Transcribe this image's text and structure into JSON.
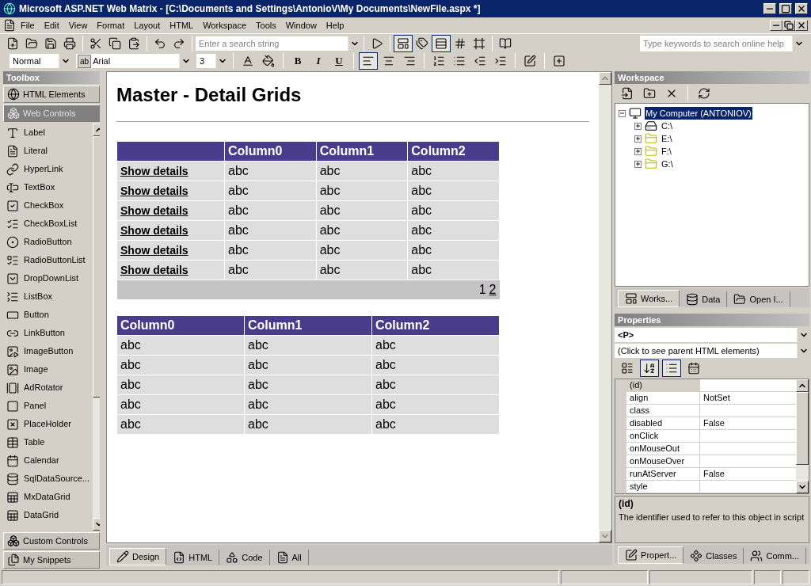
{
  "window": {
    "title": "Microsoft ASP.NET Web Matrix - [C:\\Documents and Settings\\AntonioV\\My Documents\\NewFile.aspx *]"
  },
  "menu": [
    "File",
    "Edit",
    "View",
    "Format",
    "Layout",
    "HTML",
    "Workspace",
    "Tools",
    "Window",
    "Help"
  ],
  "toolbar": {
    "search": {
      "placeholder": "Enter a search string"
    },
    "help_search": {
      "placeholder": "Type keywords to search online help"
    },
    "view_buttons": [
      {
        "selected": true
      },
      {
        "selected": false
      },
      {
        "selected": true
      },
      {
        "selected": false
      },
      {
        "selected": false
      }
    ]
  },
  "format_bar": {
    "block_format": "Normal",
    "font": "Arial",
    "font_prefix": "ab",
    "size": "3",
    "bold": "B",
    "italic": "I",
    "underline": "U",
    "align": [
      {
        "selected": true
      },
      {
        "selected": false
      },
      {
        "selected": false
      }
    ]
  },
  "toolbox": {
    "title": "Toolbox",
    "sections_top": [
      {
        "label": "HTML Elements",
        "selected": false
      },
      {
        "label": "Web Controls",
        "selected": true
      }
    ],
    "items": [
      "Label",
      "Literal",
      "HyperLink",
      "TextBox",
      "CheckBox",
      "CheckBoxList",
      "RadioButton",
      "RadioButtonList",
      "DropDownList",
      "ListBox",
      "Button",
      "LinkButton",
      "ImageButton",
      "Image",
      "AdRotator",
      "Panel",
      "PlaceHolder",
      "Table",
      "Calendar",
      "SqlDataSource...",
      "MxDataGrid",
      "DataGrid"
    ],
    "sections_bottom": [
      {
        "label": "Custom Controls",
        "selected": false
      },
      {
        "label": "My Snippets",
        "selected": false
      }
    ]
  },
  "document": {
    "heading": "Master - Detail Grids",
    "master_grid": {
      "columns": [
        "",
        "Column0",
        "Column1",
        "Column2"
      ],
      "rows": [
        [
          "Show details",
          "abc",
          "abc",
          "abc"
        ],
        [
          "Show details",
          "abc",
          "abc",
          "abc"
        ],
        [
          "Show details",
          "abc",
          "abc",
          "abc"
        ],
        [
          "Show details",
          "abc",
          "abc",
          "abc"
        ],
        [
          "Show details",
          "abc",
          "abc",
          "abc"
        ],
        [
          "Show details",
          "abc",
          "abc",
          "abc"
        ]
      ],
      "pager": [
        {
          "label": "1",
          "selected": true
        },
        {
          "label": "2",
          "selected": false
        }
      ]
    },
    "detail_grid": {
      "columns": [
        "Column0",
        "Column1",
        "Column2"
      ],
      "rows": [
        [
          "abc",
          "abc",
          "abc"
        ],
        [
          "abc",
          "abc",
          "abc"
        ],
        [
          "abc",
          "abc",
          "abc"
        ],
        [
          "abc",
          "abc",
          "abc"
        ],
        [
          "abc",
          "abc",
          "abc"
        ]
      ]
    }
  },
  "editor_tabs": [
    {
      "label": "Design",
      "selected": true
    },
    {
      "label": "HTML",
      "selected": false
    },
    {
      "label": "Code",
      "selected": false
    },
    {
      "label": "All",
      "selected": false
    }
  ],
  "workspace": {
    "title": "Workspace",
    "tree": [
      {
        "label": "My Computer (ANTONIOV)",
        "selected": true,
        "expanded": true,
        "children": [
          {
            "label": "C:\\",
            "selected": false,
            "expanded": false
          },
          {
            "label": "E:\\",
            "selected": false,
            "expanded": false
          },
          {
            "label": "F:\\",
            "selected": false,
            "expanded": false
          },
          {
            "label": "G:\\",
            "selected": false,
            "expanded": false
          }
        ]
      }
    ],
    "tabs": [
      {
        "label": "Works...",
        "selected": true
      },
      {
        "label": "Data",
        "selected": false
      },
      {
        "label": "Open I...",
        "selected": false
      }
    ]
  },
  "properties": {
    "title": "Properties",
    "element": "<P>",
    "parent_hint": "(Click to see parent HTML elements)",
    "tool_buttons": [
      {
        "selected": false
      },
      {
        "selected": true
      },
      {
        "selected": true
      },
      {
        "selected": false
      }
    ],
    "rows": [
      {
        "name": "(id)",
        "value": "",
        "selected": true
      },
      {
        "name": "align",
        "value": "NotSet",
        "selected": false
      },
      {
        "name": "class",
        "value": "",
        "selected": false
      },
      {
        "name": "disabled",
        "value": "False",
        "selected": false
      },
      {
        "name": "onClick",
        "value": "",
        "selected": false
      },
      {
        "name": "onMouseOut",
        "value": "",
        "selected": false
      },
      {
        "name": "onMouseOver",
        "value": "",
        "selected": false
      },
      {
        "name": "runAtServer",
        "value": "False",
        "selected": false
      },
      {
        "name": "style",
        "value": "",
        "selected": false
      }
    ],
    "description_title": "(id)",
    "description": "The identifier used to refer to this object in script",
    "tabs": [
      {
        "label": "Propert...",
        "selected": true
      },
      {
        "label": "Classes",
        "selected": false
      },
      {
        "label": "Comm...",
        "selected": false
      }
    ]
  }
}
